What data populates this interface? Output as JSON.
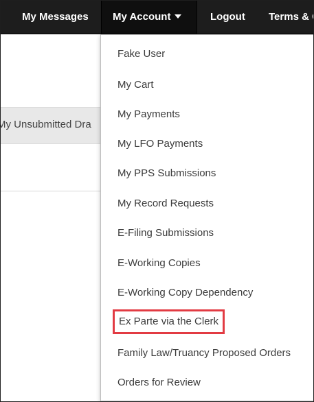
{
  "navbar": {
    "messages": "My Messages",
    "account": "My Account",
    "logout": "Logout",
    "terms": "Terms & C"
  },
  "sidebar": {
    "tab_label": "My Unsubmitted Dra"
  },
  "dropdown": {
    "items": [
      "Fake User",
      "My Cart",
      "My Payments",
      "My LFO Payments",
      "My PPS Submissions",
      "My Record Requests",
      "E-Filing Submissions",
      "E-Working Copies",
      "E-Working Copy Dependency",
      "Ex Parte via the Clerk",
      "Family Law/Truancy Proposed Orders",
      "Orders for Review"
    ],
    "highlighted_item": "Ex Parte via the Clerk",
    "highlight_color": "#e23b43"
  },
  "icons": {
    "account_dropdown": "caret-down-icon"
  }
}
